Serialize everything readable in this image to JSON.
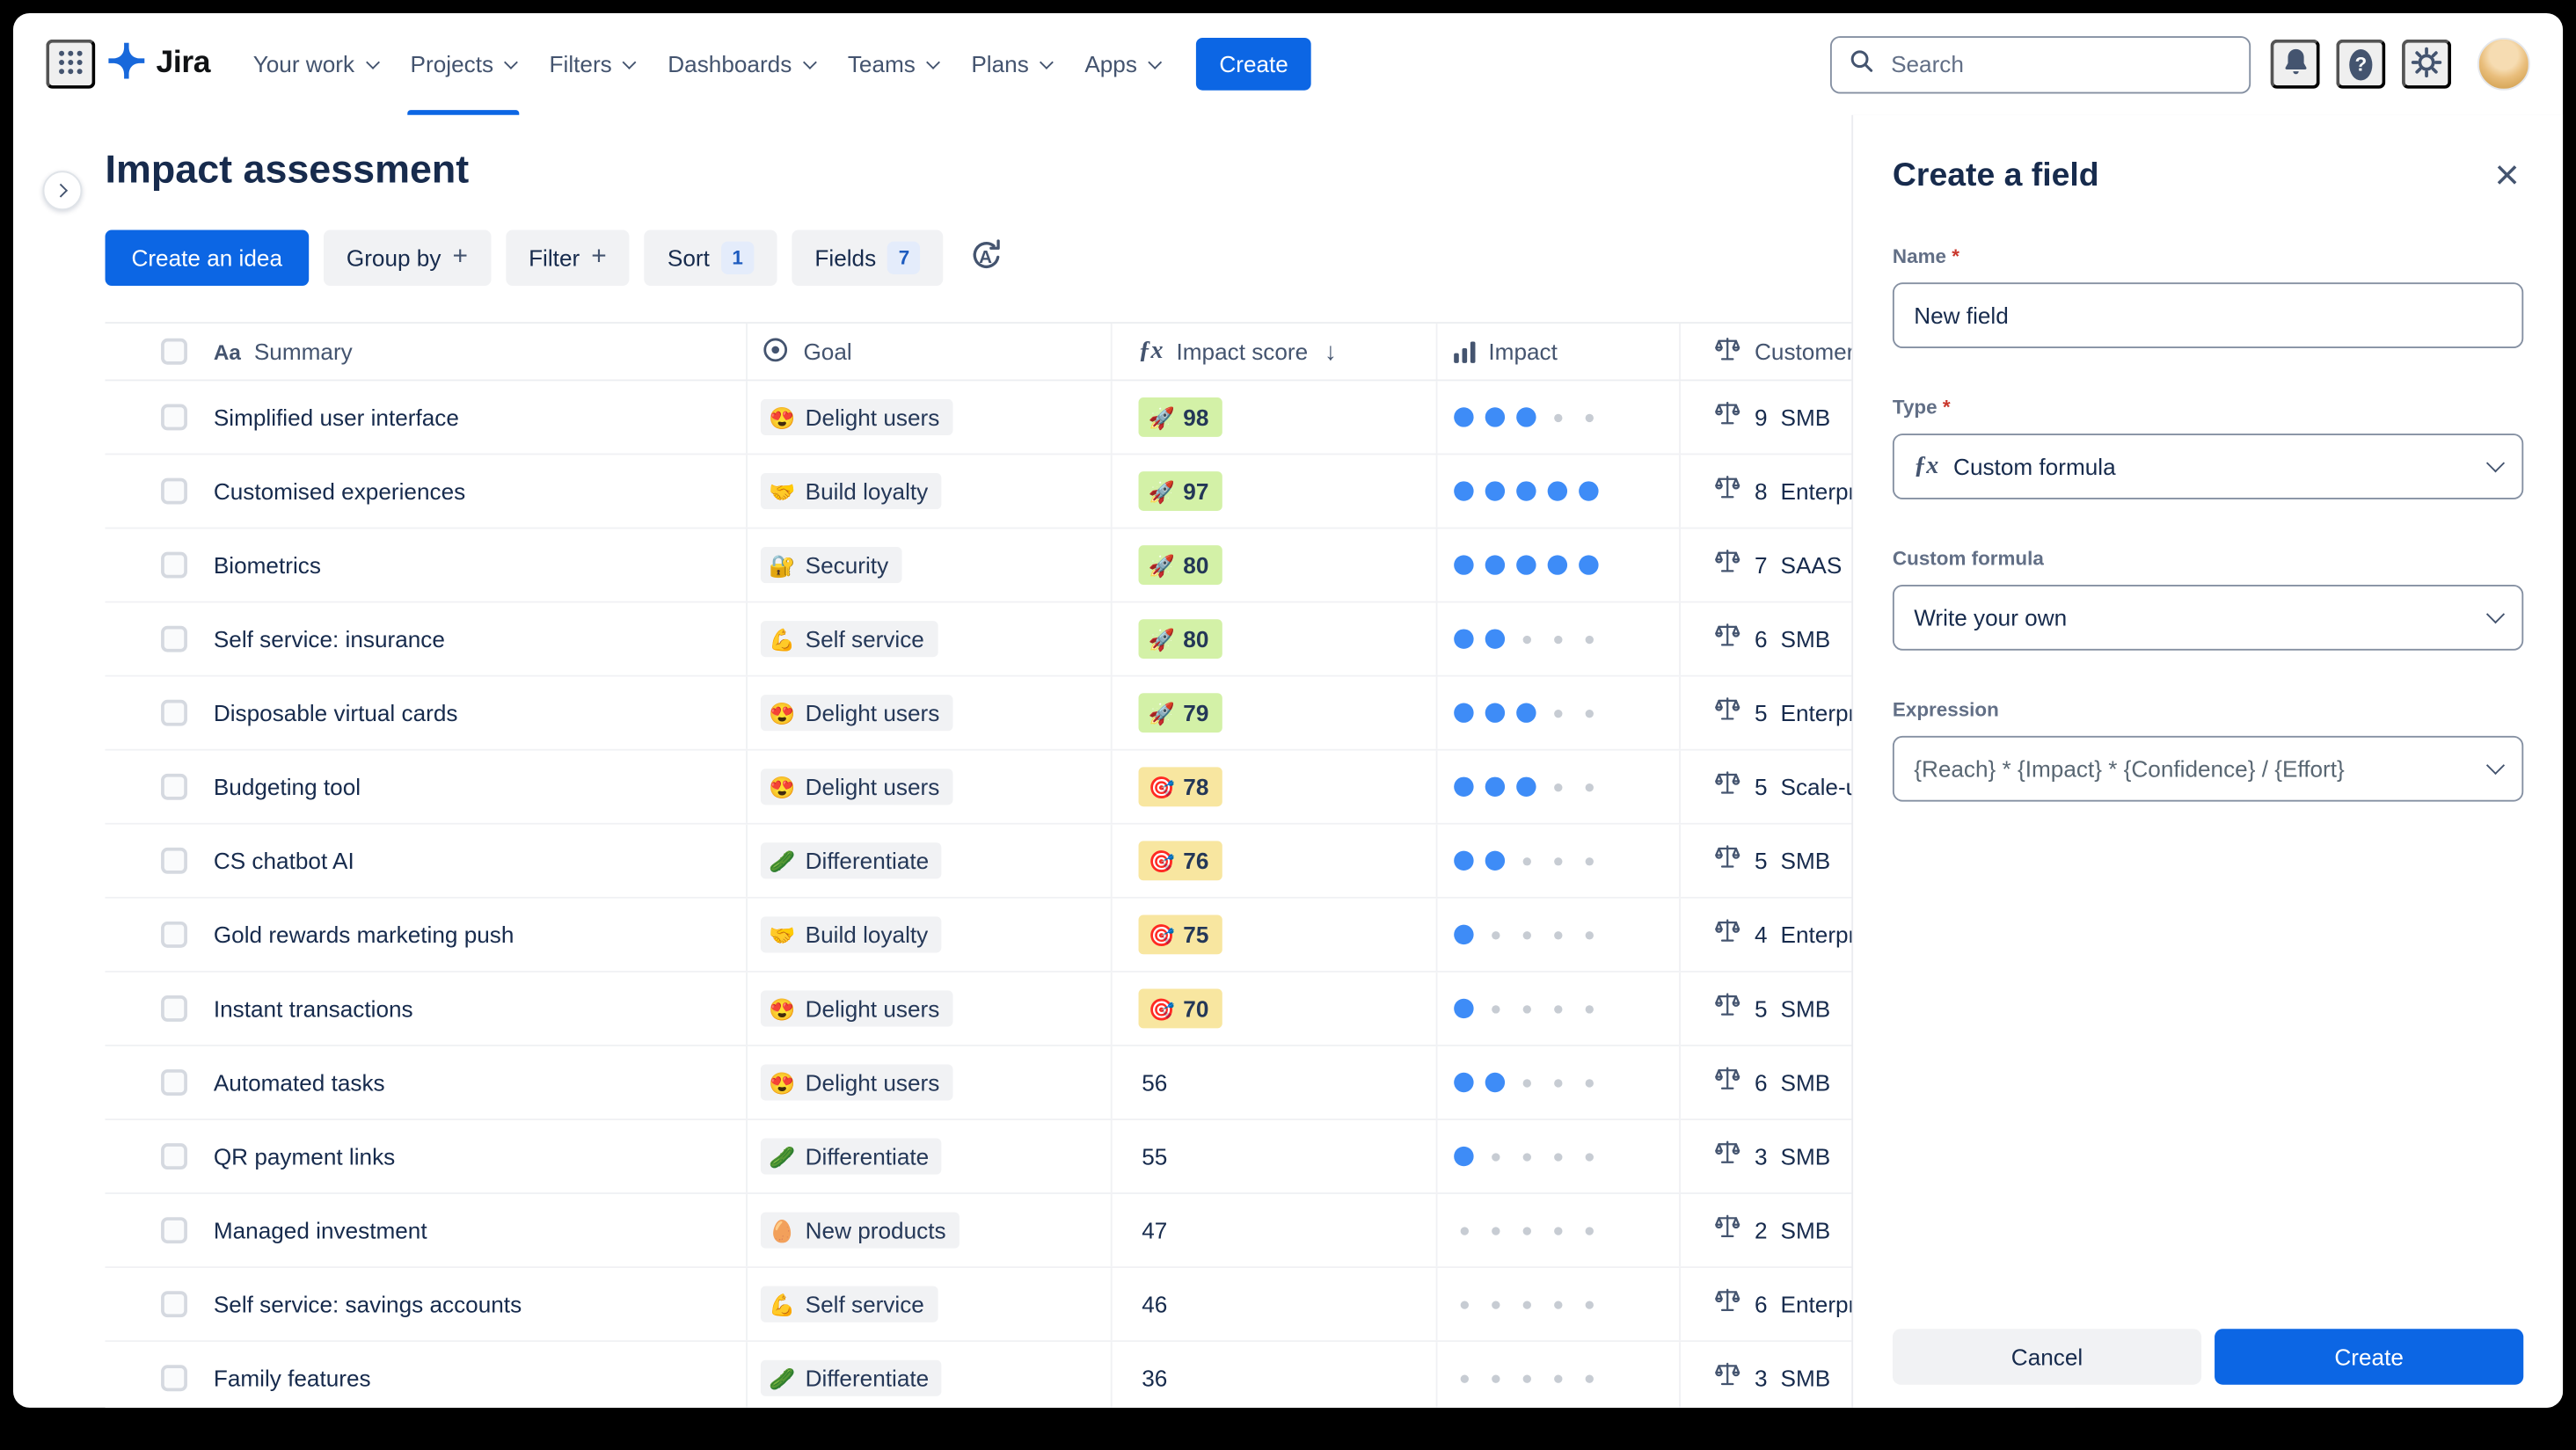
{
  "app": {
    "brand": "Jira",
    "nav_items": [
      "Your work",
      "Projects",
      "Filters",
      "Dashboards",
      "Teams",
      "Plans",
      "Apps"
    ],
    "active_nav": "Projects",
    "create_button": "Create",
    "search_placeholder": "Search"
  },
  "header": {
    "title": "Impact assessment"
  },
  "toolbar": {
    "create_idea": "Create an idea",
    "group_by": "Group by",
    "filter": "Filter",
    "sort": "Sort",
    "sort_count": "1",
    "fields": "Fields",
    "fields_count": "7"
  },
  "table": {
    "columns": [
      {
        "key": "summary",
        "label": "Summary"
      },
      {
        "key": "goal",
        "label": "Goal"
      },
      {
        "key": "impact_score",
        "label": "Impact score",
        "sorted": "desc"
      },
      {
        "key": "impact",
        "label": "Impact"
      },
      {
        "key": "customer",
        "label": "Customer"
      }
    ],
    "rows": [
      {
        "summary": "Simplified user interface",
        "goal_emoji": "😍",
        "goal": "Delight users",
        "score": 98,
        "score_icon": "🚀",
        "score_tone": "green",
        "impact": 3,
        "customer_count": 9,
        "customer": "SMB"
      },
      {
        "summary": "Customised experiences",
        "goal_emoji": "🤝",
        "goal": "Build loyalty",
        "score": 97,
        "score_icon": "🚀",
        "score_tone": "green",
        "impact": 5,
        "customer_count": 8,
        "customer": "Enterprise"
      },
      {
        "summary": "Biometrics",
        "goal_emoji": "🔐",
        "goal": "Security",
        "score": 80,
        "score_icon": "🚀",
        "score_tone": "green",
        "impact": 5,
        "customer_count": 7,
        "customer": "SAAS"
      },
      {
        "summary": "Self service: insurance",
        "goal_emoji": "💪",
        "goal": "Self service",
        "score": 80,
        "score_icon": "🚀",
        "score_tone": "green",
        "impact": 2,
        "customer_count": 6,
        "customer": "SMB"
      },
      {
        "summary": "Disposable virtual cards",
        "goal_emoji": "😍",
        "goal": "Delight users",
        "score": 79,
        "score_icon": "🚀",
        "score_tone": "green",
        "impact": 3,
        "customer_count": 5,
        "customer": "Enterprise"
      },
      {
        "summary": "Budgeting tool",
        "goal_emoji": "😍",
        "goal": "Delight users",
        "score": 78,
        "score_icon": "🎯",
        "score_tone": "yellow",
        "impact": 3,
        "customer_count": 5,
        "customer": "Scale-ups"
      },
      {
        "summary": "CS chatbot AI",
        "goal_emoji": "🥒",
        "goal": "Differentiate",
        "score": 76,
        "score_icon": "🎯",
        "score_tone": "yellow",
        "impact": 2,
        "customer_count": 5,
        "customer": "SMB"
      },
      {
        "summary": "Gold rewards marketing push",
        "goal_emoji": "🤝",
        "goal": "Build loyalty",
        "score": 75,
        "score_icon": "🎯",
        "score_tone": "yellow",
        "impact": 1,
        "customer_count": 4,
        "customer": "Enterprise"
      },
      {
        "summary": "Instant transactions",
        "goal_emoji": "😍",
        "goal": "Delight users",
        "score": 70,
        "score_icon": "🎯",
        "score_tone": "yellow",
        "impact": 1,
        "customer_count": 5,
        "customer": "SMB"
      },
      {
        "summary": "Automated tasks",
        "goal_emoji": "😍",
        "goal": "Delight users",
        "score": 56,
        "score_icon": null,
        "score_tone": "none",
        "impact": 2,
        "customer_count": 6,
        "customer": "SMB"
      },
      {
        "summary": "QR payment links",
        "goal_emoji": "🥒",
        "goal": "Differentiate",
        "score": 55,
        "score_icon": null,
        "score_tone": "none",
        "impact": 1,
        "customer_count": 3,
        "customer": "SMB"
      },
      {
        "summary": "Managed investment",
        "goal_emoji": "🥚",
        "goal": "New products",
        "score": 47,
        "score_icon": null,
        "score_tone": "none",
        "impact": 0,
        "customer_count": 2,
        "customer": "SMB"
      },
      {
        "summary": "Self service: savings accounts",
        "goal_emoji": "💪",
        "goal": "Self service",
        "score": 46,
        "score_icon": null,
        "score_tone": "none",
        "impact": 0,
        "customer_count": 6,
        "customer": "Enterprise"
      },
      {
        "summary": "Family features",
        "goal_emoji": "🥒",
        "goal": "Differentiate",
        "score": 36,
        "score_icon": null,
        "score_tone": "none",
        "impact": 0,
        "customer_count": 3,
        "customer": "SMB"
      }
    ]
  },
  "panel": {
    "title": "Create a field",
    "name_label": "Name",
    "name_value": "New field",
    "type_label": "Type",
    "type_value": "Custom formula",
    "formula_label": "Custom formula",
    "formula_value": "Write your own",
    "expression_label": "Expression",
    "expression_value": "{Reach} * {Impact} * {Confidence} / {Effort}",
    "cancel_label": "Cancel",
    "create_label": "Create"
  },
  "colors": {
    "accent_blue": "#0C66E4",
    "score_green": "#D3F1A7",
    "score_yellow": "#F8E6A0",
    "impact_dot_blue": "#3E8CF7"
  }
}
